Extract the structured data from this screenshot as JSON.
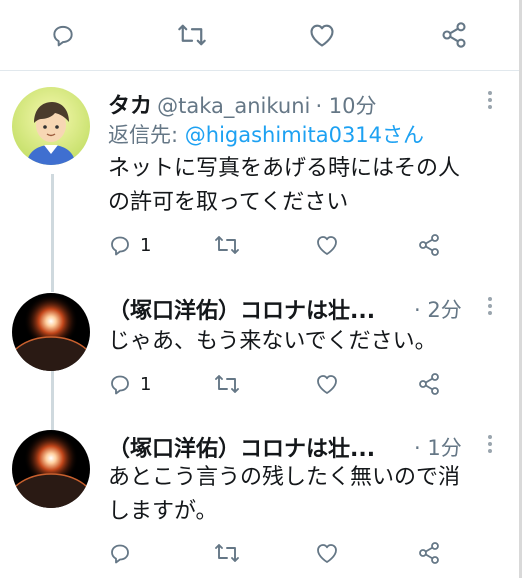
{
  "top_actions": {
    "reply_icon": "comment-icon",
    "retweet_icon": "retweet-icon",
    "like_icon": "heart-icon",
    "share_icon": "share-icon"
  },
  "tweets": [
    {
      "display_name": "タカ",
      "handle": "@taka_anikuni",
      "time": "· 10分",
      "reply_prefix": "返信先: ",
      "reply_target": "@higashimita0314さん",
      "text_line1": "ネットに写真をあげる時にはその人",
      "text_line2": "の許可を取ってください",
      "reply_count": "1"
    },
    {
      "display_name": "（塚口洋佑）コロナは壮...",
      "time": "· 2分",
      "text_line1": "じゃあ、もう来ないでください。",
      "reply_count": "1"
    },
    {
      "display_name": "（塚口洋佑）コロナは壮...",
      "time": "· 1分",
      "text_line1": "あとこう言うの残したく無いので消",
      "text_line2": "しますが。"
    }
  ],
  "colors": {
    "accent": "#1da1f2",
    "muted": "#657786",
    "text": "#14171a"
  }
}
